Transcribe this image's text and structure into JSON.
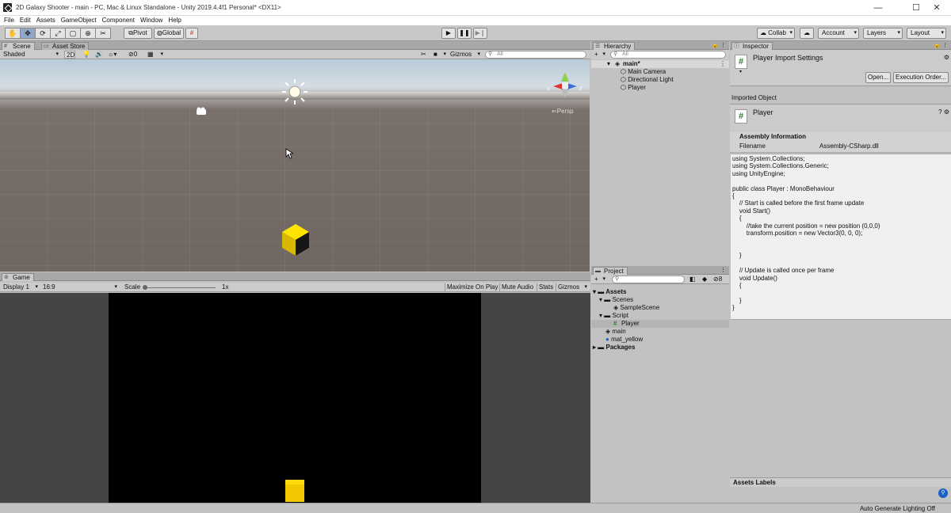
{
  "window": {
    "title": "2D Galaxy Shooter - main - PC, Mac & Linux Standalone - Unity 2019.4.4f1 Personal* <DX11>"
  },
  "menu": [
    "File",
    "Edit",
    "Assets",
    "GameObject",
    "Component",
    "Window",
    "Help"
  ],
  "toolbar": {
    "pivot": "Pivot",
    "global": "Global",
    "collab": "Collab",
    "account": "Account",
    "layers": "Layers",
    "layout": "Layout"
  },
  "scene": {
    "tab": "Scene",
    "asset_store_tab": "Asset Store",
    "shading": "Shaded",
    "mode_2d": "2D",
    "hidden_count": "0",
    "gizmos": "Gizmos",
    "search_placeholder": "All",
    "persp": "Persp",
    "gizmo_x": "x",
    "gizmo_z": "z"
  },
  "game": {
    "tab": "Game",
    "display": "Display 1",
    "aspect": "16:9",
    "scale_label": "Scale",
    "scale_value": "1x",
    "maximize": "Maximize On Play",
    "mute": "Mute Audio",
    "stats": "Stats",
    "gizmos": "Gizmos"
  },
  "hierarchy": {
    "tab": "Hierarchy",
    "search_placeholder": "All",
    "scene_name": "main*",
    "items": [
      "Main Camera",
      "Directional Light",
      "Player"
    ]
  },
  "project": {
    "tab": "Project",
    "badge": "8",
    "assets": "Assets",
    "scenes": "Scenes",
    "sample_scene": "SampleScene",
    "script": "Script",
    "player": "Player",
    "main": "main",
    "mat_yellow": "mat_yellow",
    "packages": "Packages"
  },
  "inspector": {
    "tab": "Inspector",
    "header_title": "Player Import Settings",
    "open_button": "Open...",
    "exec_order_button": "Execution Order...",
    "imported_object": "Imported Object",
    "object_name": "Player",
    "assembly_info": "Assembly Information",
    "filename_label": "Filename",
    "filename_value": "Assembly-CSharp.dll",
    "asset_labels": "Assets Labels"
  },
  "code": "using System.Collections;\nusing System.Collections.Generic;\nusing UnityEngine;\n\npublic class Player : MonoBehaviour\n{\n    // Start is called before the first frame update\n    void Start()\n    {\n        //take the current position = new position (0,0,0)\n        transform.position = new Vector3(0, 0, 0);\n\n\n    }\n\n    // Update is called once per frame\n    void Update()\n    {\n\n    }\n}",
  "status": {
    "text": "Auto Generate Lighting Off"
  },
  "colors": {
    "cube": "#f2d400",
    "sky": "#b9cbd8",
    "ground": "#6e645f",
    "selection": "#b4b4b4"
  }
}
